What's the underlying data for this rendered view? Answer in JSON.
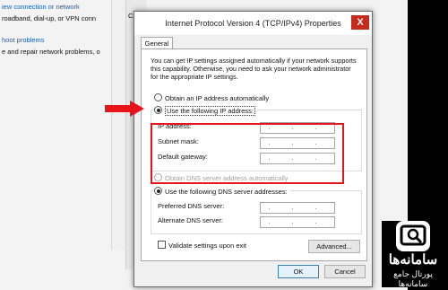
{
  "background": {
    "lines": [
      "iew connection or network",
      "roadband, dial-up, or VPN conn",
      "hoot problems",
      "e and repair network problems, o"
    ],
    "fragment": "C"
  },
  "dialog": {
    "title": "Internet Protocol Version 4 (TCP/IPv4) Properties",
    "close_label": "X",
    "tab_label": "General",
    "description": "You can get IP settings assigned automatically if your network supports this capability. Otherwise, you need to ask your network administrator for the appropriate IP settings.",
    "obtain_ip_label": "Obtain an IP address automatically",
    "use_ip_label": "Use the following IP address:",
    "ip_label": "IP address:",
    "subnet_label": "Subnet mask:",
    "gateway_label": "Default gateway:",
    "ip_value": ". . .",
    "subnet_value": ". . .",
    "gateway_value": ". . .",
    "obtain_dns_label": "Obtain DNS server address automatically",
    "use_dns_label": "Use the following DNS server addresses:",
    "preferred_dns_label": "Preferred DNS server:",
    "alternate_dns_label": "Alternate DNS server:",
    "preferred_dns_value": ". . .",
    "alternate_dns_value": ". . .",
    "validate_label": "Validate settings upon exit",
    "advanced_label": "Advanced...",
    "ok_label": "OK",
    "cancel_label": "Cancel",
    "selected_ip_option": "use",
    "selected_dns_option": "use"
  },
  "watermark": {
    "name": "سامانه‌ها",
    "subtitle": "پورتال جامع سامانه‌ها"
  },
  "colors": {
    "highlight": "#e8141b",
    "close": "#c42b1c"
  }
}
